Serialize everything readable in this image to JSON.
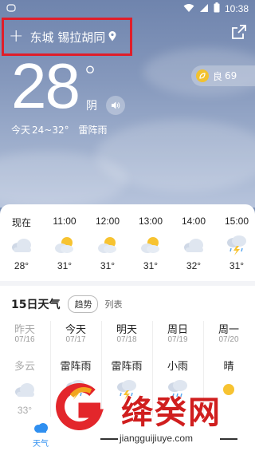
{
  "status_bar": {
    "time": "10:38",
    "icons": [
      "message-icon",
      "wifi-icon",
      "signal-icon",
      "battery-icon"
    ]
  },
  "header": {
    "add_symbol": "+",
    "location": "东城 锡拉胡同",
    "share_icon": "share-icon",
    "highlight_color": "#e01e2a"
  },
  "current": {
    "temperature": "28",
    "degree_symbol": "°",
    "condition": "阴",
    "today_label": "今天",
    "today_range": "24~32°",
    "today_condition": "雷阵雨",
    "aqi_label": "良",
    "aqi_value": "69"
  },
  "hourly": [
    {
      "time": "现在",
      "icon": "cloudy-icon",
      "temp": "28°"
    },
    {
      "time": "11:00",
      "icon": "partly-cloudy-icon",
      "temp": "31°"
    },
    {
      "time": "12:00",
      "icon": "partly-cloudy-icon",
      "temp": "31°"
    },
    {
      "time": "13:00",
      "icon": "partly-cloudy-icon",
      "temp": "31°"
    },
    {
      "time": "14:00",
      "icon": "cloudy-icon",
      "temp": "32°"
    },
    {
      "time": "15:00",
      "icon": "thunderstorm-icon",
      "temp": "31°"
    }
  ],
  "forecast": {
    "title": "15日天气",
    "tab_active": "趋势",
    "tab_other": "列表",
    "days": [
      {
        "name": "昨天",
        "date": "07/16",
        "condition": "多云",
        "icon": "cloudy-icon",
        "temp": "33°",
        "past": true
      },
      {
        "name": "今天",
        "date": "07/17",
        "condition": "雷阵雨",
        "icon": "thunderstorm-icon",
        "temp": "",
        "past": false
      },
      {
        "name": "明天",
        "date": "07/18",
        "condition": "雷阵雨",
        "icon": "thunderstorm-icon",
        "temp": "",
        "past": false
      },
      {
        "name": "周日",
        "date": "07/19",
        "condition": "小雨",
        "icon": "rain-icon",
        "temp": "",
        "past": false
      },
      {
        "name": "周一",
        "date": "07/20",
        "condition": "晴",
        "icon": "sun-icon",
        "temp": "",
        "past": false
      }
    ]
  },
  "bottom_nav": {
    "weather_label": "天气"
  },
  "watermark": {
    "text": "绛癸网",
    "url": "jiangguijiuye.com"
  }
}
